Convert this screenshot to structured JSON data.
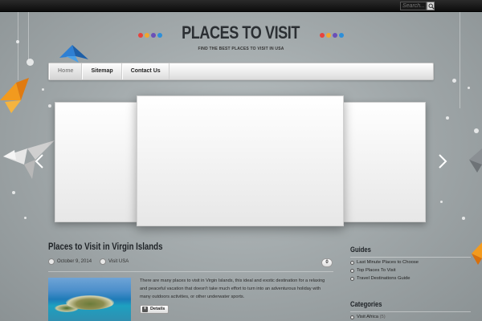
{
  "header": {
    "search_placeholder": "Search...",
    "site_title": "PLACES TO VISIT",
    "tagline": "FIND THE BEST PLACES TO VISIT IN USA",
    "logo_dot_colors": [
      "#e8423d",
      "#f0a830",
      "#6a4fb8",
      "#2d8fd9"
    ]
  },
  "nav": {
    "items": [
      {
        "label": "Home"
      },
      {
        "label": "Sitemap"
      },
      {
        "label": "Contact Us"
      }
    ]
  },
  "slider": {
    "prev_icon": "chevron-left-icon",
    "next_icon": "chevron-right-icon"
  },
  "post": {
    "title": "Places to Visit in Virgin Islands",
    "date": "October 9, 2014",
    "category": "Visit USA",
    "comment_count": "0",
    "excerpt": "There are many places to visit in Virgin Islands, this ideal and exotic destination for a relaxing and peaceful vacation that doesn't take much effort to turn into an adventurous holiday with many outdoors activities, or other underwater sports.",
    "details_label": "Details"
  },
  "sidebar": {
    "guides_title": "Guides",
    "guides": [
      {
        "label": "Last Minute Places to Choose"
      },
      {
        "label": "Top Places To Visit"
      },
      {
        "label": "Travel Destinations Guide"
      }
    ],
    "categories_title": "Categories",
    "categories": [
      {
        "label": "Visit Africa",
        "count": "(5)"
      }
    ]
  }
}
